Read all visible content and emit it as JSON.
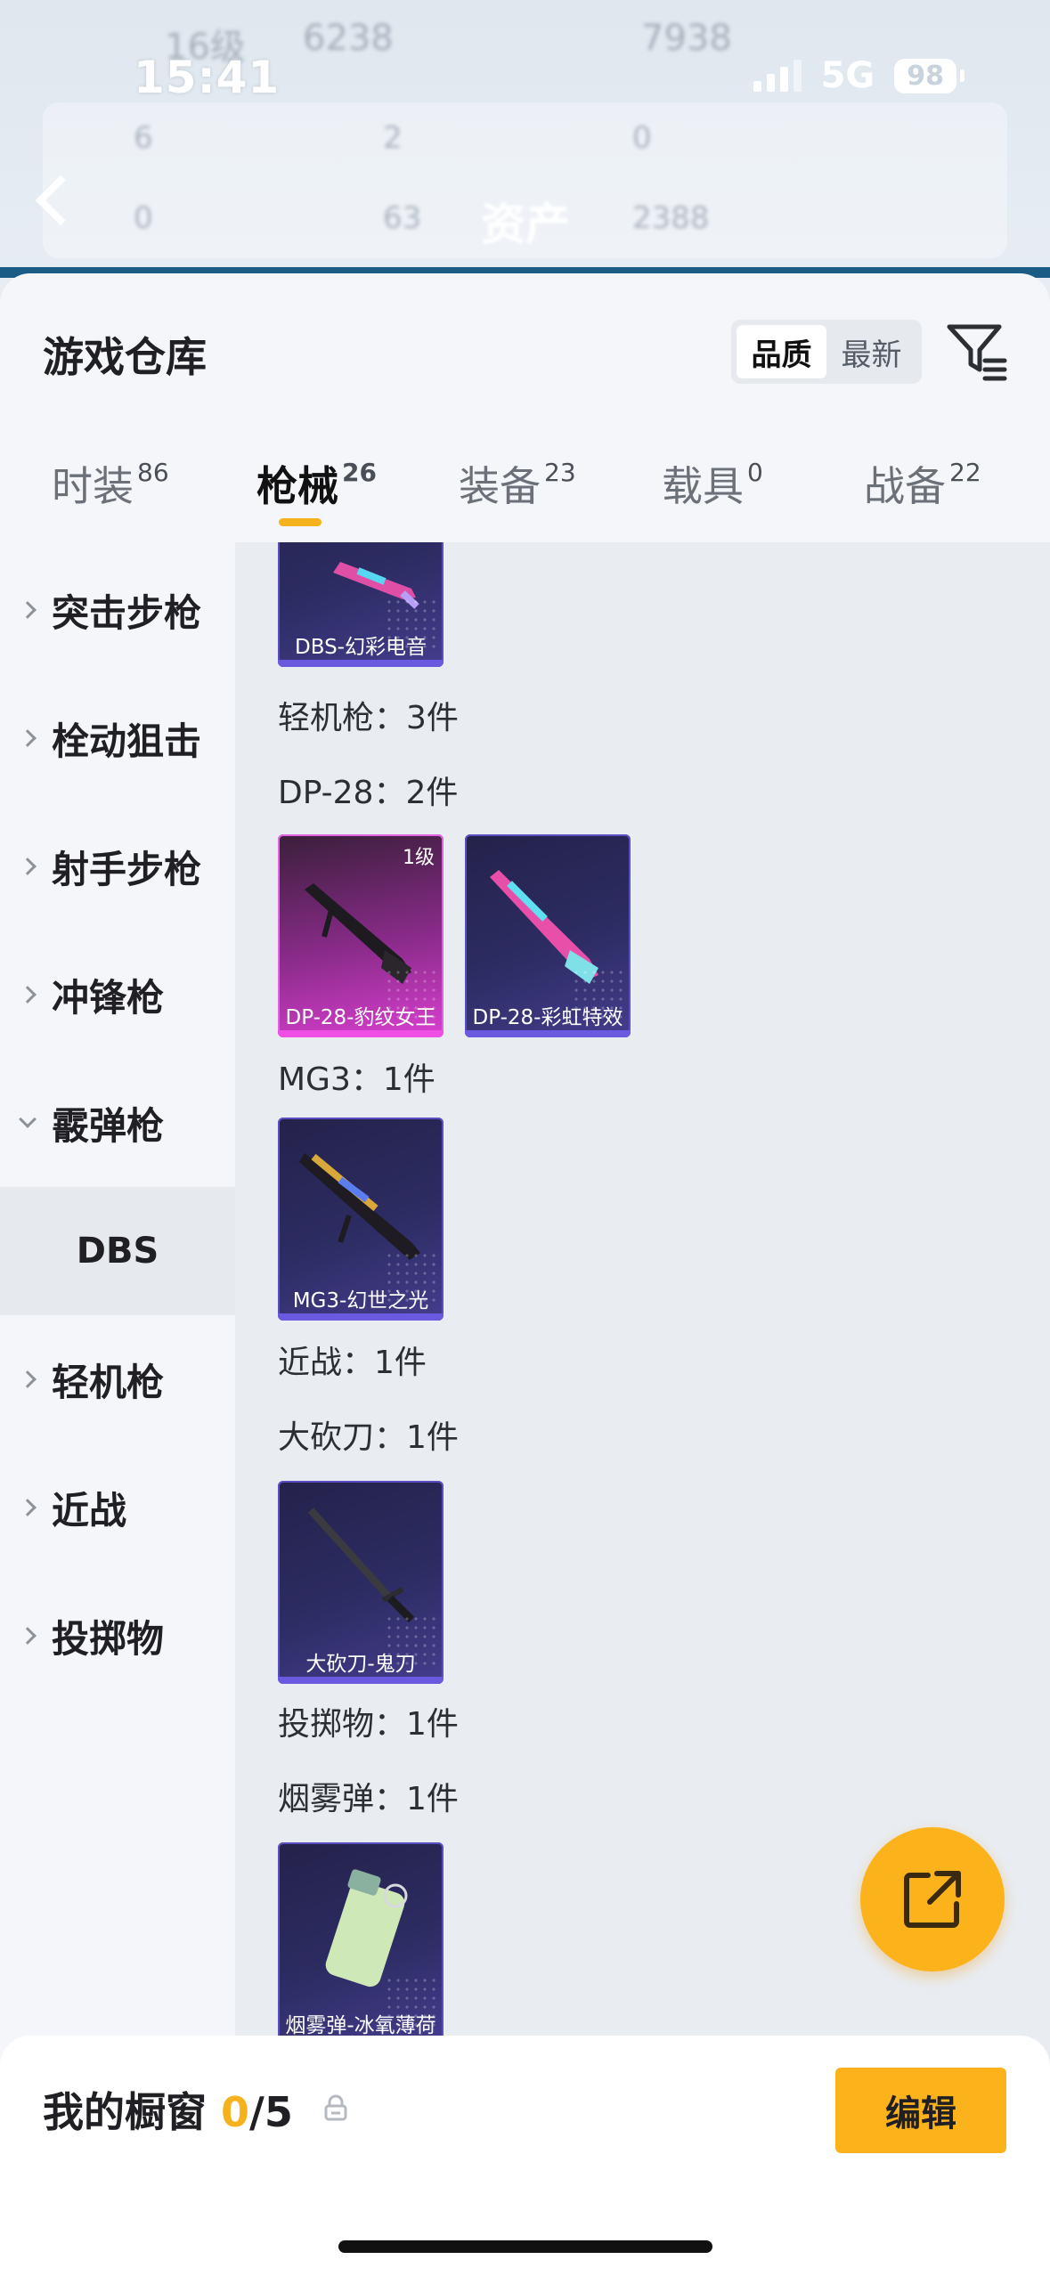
{
  "status_bar": {
    "time": "15:41",
    "network": "5G",
    "battery": "98"
  },
  "background_ghost": {
    "level": "16级",
    "coins": "6238",
    "points": "7938",
    "stat1": "6",
    "stat2": "2",
    "stat3": "0",
    "stat4": "0",
    "stat5": "63",
    "stat6": "2388",
    "title": "资产"
  },
  "header": {
    "title": "游戏仓库",
    "sort": {
      "quality": "品质",
      "latest": "最新"
    }
  },
  "tabs": [
    {
      "label": "时装",
      "count": "86"
    },
    {
      "label": "枪械",
      "count": "26"
    },
    {
      "label": "装备",
      "count": "23"
    },
    {
      "label": "载具",
      "count": "0"
    },
    {
      "label": "战备",
      "count": "22"
    }
  ],
  "sidebar": {
    "items": [
      {
        "label": "突击步枪"
      },
      {
        "label": "栓动狙击"
      },
      {
        "label": "射手步枪"
      },
      {
        "label": "冲锋枪"
      },
      {
        "label": "霰弹枪"
      },
      {
        "label": "轻机枪"
      },
      {
        "label": "近战"
      },
      {
        "label": "投掷物"
      }
    ],
    "sub_selected": "DBS"
  },
  "content": {
    "dbs_card": {
      "name": "DBS-幻彩电音"
    },
    "lmg_label": "轻机枪：3件",
    "dp28_label": "DP-28：2件",
    "dp28_cards": [
      {
        "name": "DP-28-豹纹女王",
        "level": "1级"
      },
      {
        "name": "DP-28-彩虹特效"
      }
    ],
    "mg3_label": "MG3：1件",
    "mg3_card": {
      "name": "MG3-幻世之光"
    },
    "melee_label": "近战：1件",
    "machete_label": "大砍刀：1件",
    "machete_card": {
      "name": "大砍刀-鬼刀"
    },
    "throw_label": "投掷物：1件",
    "smoke_label": "烟雾弹：1件",
    "smoke_card": {
      "name": "烟雾弹-冰氧薄荷"
    }
  },
  "bottom": {
    "showcase_label": "我的橱窗",
    "showcase_count": "0",
    "showcase_total": "/5",
    "edit": "编辑"
  },
  "colors": {
    "accent": "#fbb21b",
    "card_purple": "#2d2c63",
    "card_pink": "#d93fd0"
  }
}
